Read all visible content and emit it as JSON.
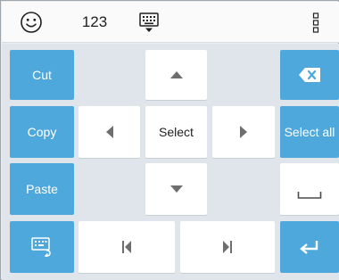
{
  "toolbar": {
    "numbers_label": "123",
    "icons": [
      "smiley-icon",
      "keyboard-hide-icon",
      "more-vert-icon"
    ]
  },
  "keys": {
    "cut": "Cut",
    "copy": "Copy",
    "paste": "Paste",
    "select": "Select",
    "select_all": "Select all"
  },
  "colors": {
    "accent": "#4ea8dc",
    "key_background": "#ffffff",
    "keyboard_background": "#dfe5ea",
    "arrow": "#6e6e6e"
  }
}
